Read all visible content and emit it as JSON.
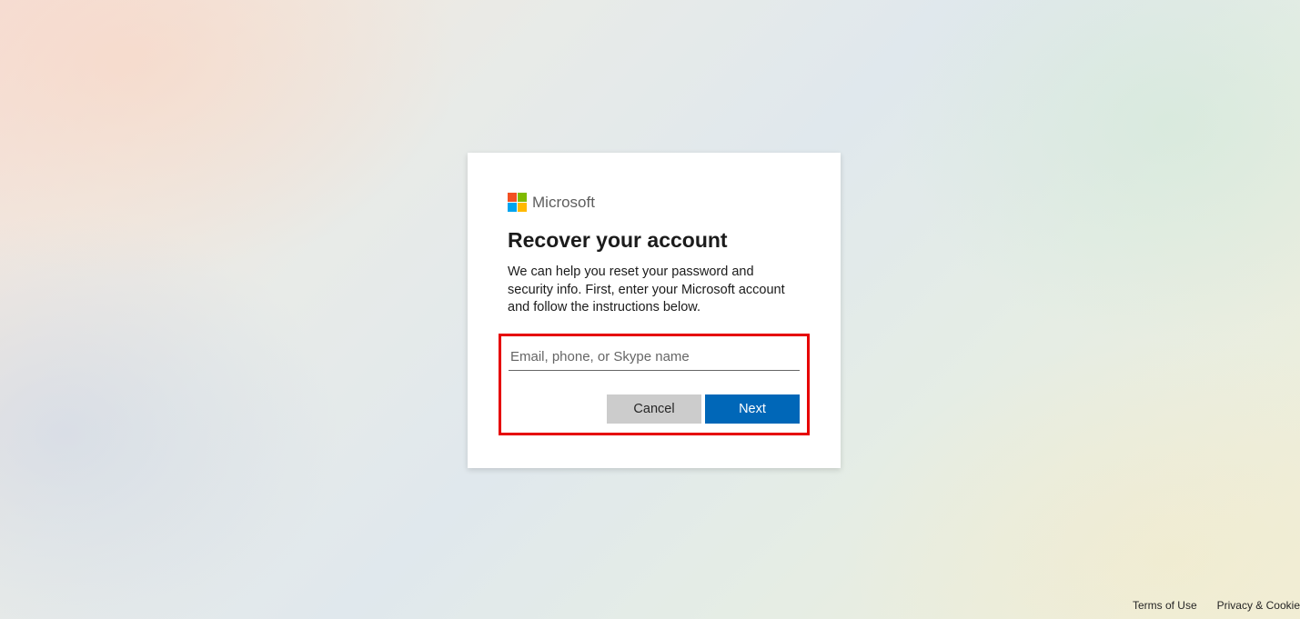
{
  "logo": {
    "text": "Microsoft",
    "colors": {
      "red": "#f25022",
      "green": "#7fba00",
      "blue": "#00a4ef",
      "yellow": "#ffb900"
    }
  },
  "card": {
    "title": "Recover your account",
    "description": "We can help you reset your password and security info. First, enter your Microsoft account and follow the instructions below.",
    "input": {
      "placeholder": "Email, phone, or Skype name",
      "value": ""
    },
    "buttons": {
      "cancel": "Cancel",
      "next": "Next"
    }
  },
  "footer": {
    "terms": "Terms of Use",
    "privacy": "Privacy & Cookie"
  },
  "highlight_color": "#e60000"
}
